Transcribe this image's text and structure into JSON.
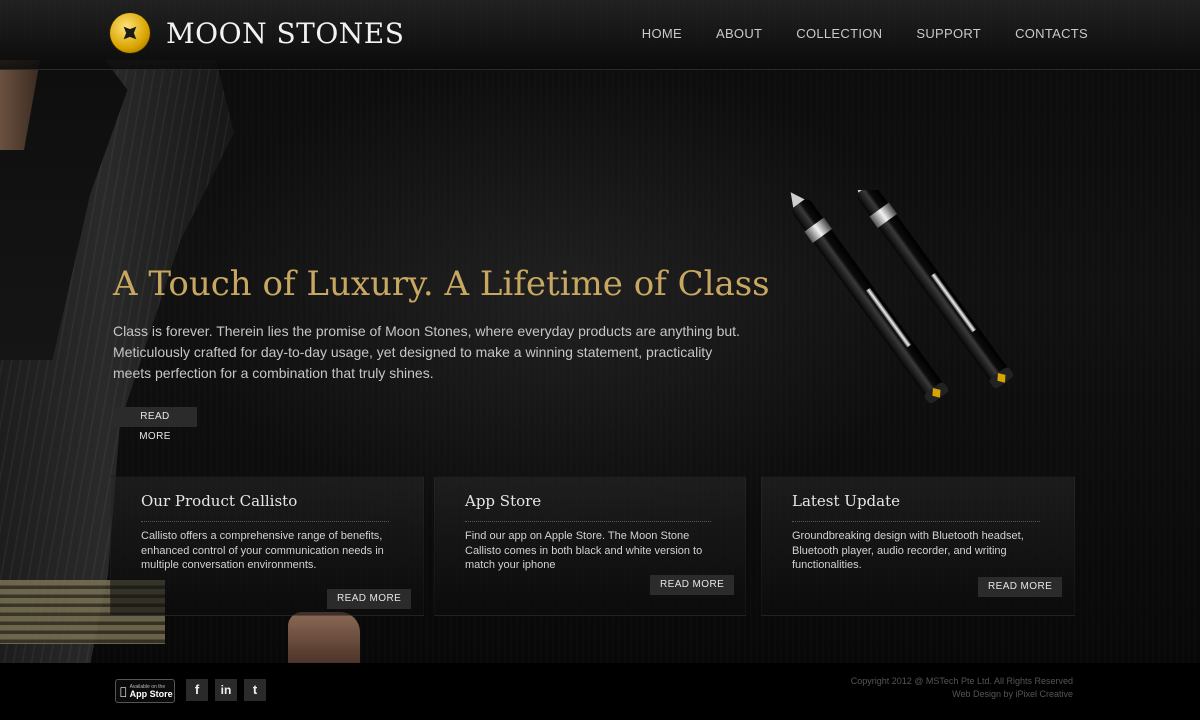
{
  "brand": {
    "name": "MOON STONES",
    "logo_icon": "diamond-star-coin-icon",
    "accent": "#c8a860",
    "logo_color": "#e0ac00"
  },
  "nav": {
    "items": [
      "HOME",
      "ABOUT",
      "COLLECTION",
      "SUPPORT",
      "CONTACTS"
    ]
  },
  "hero": {
    "title": "A Touch of Luxury. A Lifetime of Class",
    "text": "Class is forever. Therein lies the promise of Moon Stones, where everyday products are anything but. Meticulously crafted for day-to-day usage, yet designed to make a winning statement, practicality meets perfection for a combination that truly shines.",
    "button": "READ MORE"
  },
  "panels": [
    {
      "title": "Our Product Callisto",
      "text": "Callisto offers a comprehensive range of benefits, enhanced control of your communication needs in multiple conversation environments.",
      "button": "READ MORE"
    },
    {
      "title": "App Store",
      "text": "Find our app on Apple Store. The Moon Stone Callisto comes in both black and white version to match your iphone",
      "button": "READ MORE"
    },
    {
      "title": "Latest Update",
      "text": "Groundbreaking design with Bluetooth headset, Bluetooth player, audio recorder, and writing functionalities.",
      "button": "READ MORE"
    }
  ],
  "footer": {
    "appstore": {
      "line1": "Available on the",
      "line2": "App Store",
      "icon": "apple-icon"
    },
    "social": [
      {
        "icon": "facebook-icon",
        "glyph": "f"
      },
      {
        "icon": "linkedin-icon",
        "glyph": "in"
      },
      {
        "icon": "twitter-icon",
        "glyph": "t"
      }
    ],
    "copyright": "Copyright 2012 @ MSTech Pte Ltd. All Rights Reserved",
    "credit": "Web Design by iPixel Creative"
  }
}
